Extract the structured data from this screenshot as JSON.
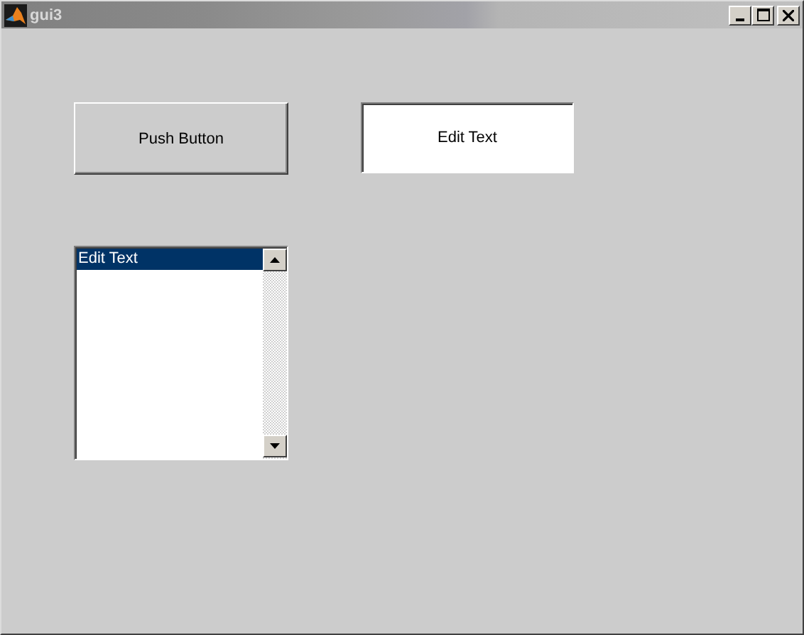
{
  "window": {
    "title": "gui3"
  },
  "push_button": {
    "label": "Push Button"
  },
  "edit_field": {
    "value": "Edit Text"
  },
  "listbox": {
    "items": [
      {
        "label": "Edit Text",
        "selected": true
      }
    ]
  }
}
